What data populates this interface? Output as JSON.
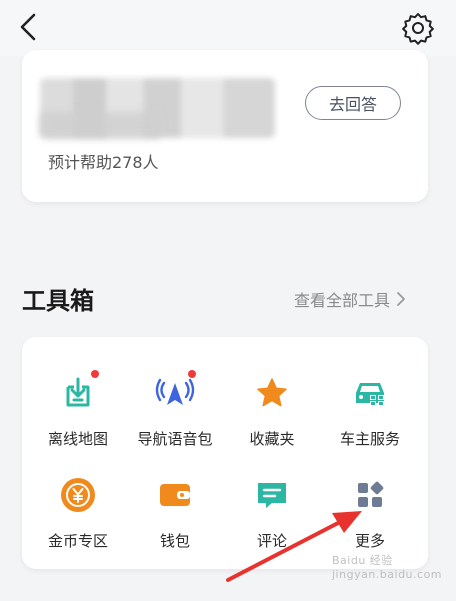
{
  "card": {
    "answer_button": "去回答",
    "help_text": "预计帮助278人"
  },
  "toolbox": {
    "title": "工具箱",
    "view_all": "查看全部工具",
    "items": [
      {
        "label": "离线地图",
        "icon": "download-map-icon",
        "badge": true
      },
      {
        "label": "导航语音包",
        "icon": "nav-voice-icon",
        "badge": true
      },
      {
        "label": "收藏夹",
        "icon": "star-icon",
        "badge": false
      },
      {
        "label": "车主服务",
        "icon": "car-service-icon",
        "badge": false
      },
      {
        "label": "金币专区",
        "icon": "coin-icon",
        "badge": false
      },
      {
        "label": "钱包",
        "icon": "wallet-icon",
        "badge": false
      },
      {
        "label": "评论",
        "icon": "comment-icon",
        "badge": false
      },
      {
        "label": "更多",
        "icon": "more-grid-icon",
        "badge": false
      }
    ]
  },
  "watermark": "Baidu 经验 jingyan.baidu.com",
  "colors": {
    "teal": "#2bb7a3",
    "blue": "#3f64e0",
    "orange": "#f08a1c",
    "slate": "#6d7b95",
    "red_arrow": "#e8322d"
  }
}
